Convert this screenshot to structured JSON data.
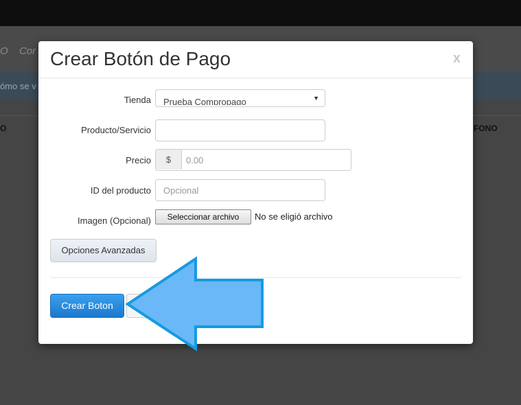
{
  "background": {
    "nav_items": [
      "O",
      "Cor"
    ],
    "alert_text": "ómo se v",
    "table_headers": [
      "O",
      "FONO"
    ]
  },
  "modal": {
    "title": "Crear Botón de Pago",
    "close": "x",
    "fields": {
      "tienda": {
        "label": "Tienda",
        "value": "Prueba Compropago"
      },
      "producto": {
        "label": "Producto/Servicio",
        "value": ""
      },
      "precio": {
        "label": "Precio",
        "addon": "$",
        "placeholder": "0.00"
      },
      "id_producto": {
        "label": "ID del producto",
        "placeholder": "Opcional"
      },
      "imagen": {
        "label": "Imagen (Opcional)",
        "button": "Seleccionar archivo",
        "status": "No se eligió archivo"
      }
    },
    "advanced_button": "Opciones Avanzadas",
    "primary_button": "Crear Boton"
  },
  "colors": {
    "primary": "#1f80d4",
    "arrow_fill": "#6ab8f7",
    "arrow_stroke": "#159be0"
  }
}
